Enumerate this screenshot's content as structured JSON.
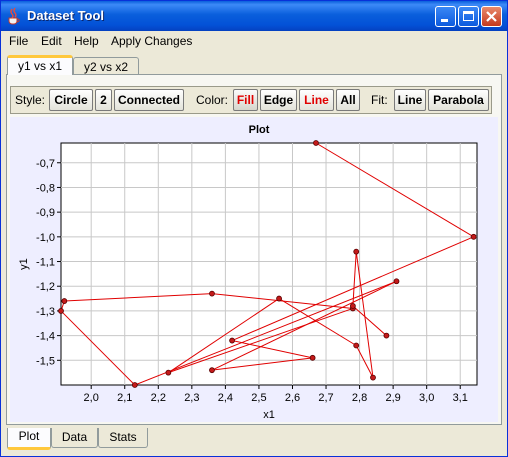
{
  "window": {
    "title": "Dataset Tool"
  },
  "menu": [
    "File",
    "Edit",
    "Help",
    "Apply Changes"
  ],
  "dataset_tabs": [
    {
      "label": "y1 vs x1",
      "active": true
    },
    {
      "label": "y2 vs x2",
      "active": false
    }
  ],
  "toolbar": {
    "style_label": "Style:",
    "style_buttons": [
      "Circle",
      "2",
      "Connected"
    ],
    "color_label": "Color:",
    "color_buttons": [
      "Fill",
      "Edge",
      "Line",
      "All"
    ],
    "fit_label": "Fit:",
    "fit_buttons": [
      "Line",
      "Parabola"
    ]
  },
  "bottom_tabs": [
    {
      "label": "Plot",
      "active": true
    },
    {
      "label": "Data",
      "active": false
    },
    {
      "label": "Stats",
      "active": false
    }
  ],
  "colors": {
    "line": "#e00000",
    "marker_fill": "#c41a1a",
    "plot_bg": "#eeeeff",
    "grid": "#c8c8c8"
  },
  "chart_data": {
    "type": "scatter",
    "title": "Plot",
    "xlabel": "x1",
    "ylabel": "y1",
    "xlim": [
      1.91,
      3.15
    ],
    "ylim": [
      -1.6,
      -0.62
    ],
    "xticks": [
      2.0,
      2.1,
      2.2,
      2.3,
      2.4,
      2.5,
      2.6,
      2.7,
      2.8,
      2.9,
      3.0,
      3.1
    ],
    "xtick_labels": [
      "2,0",
      "2,1",
      "2,2",
      "2,3",
      "2,4",
      "2,5",
      "2,6",
      "2,7",
      "2,8",
      "2,9",
      "3,0",
      "3,1"
    ],
    "yticks": [
      -0.7,
      -0.8,
      -0.9,
      -1.0,
      -1.1,
      -1.2,
      -1.3,
      -1.4,
      -1.5
    ],
    "ytick_labels": [
      "-0,7",
      "-0,8",
      "-0,9",
      "-1,0",
      "-1,1",
      "-1,2",
      "-1,3",
      "-1,4",
      "-1,5"
    ],
    "connected": true,
    "marker": "circle",
    "points": [
      {
        "x": 2.67,
        "y": -0.62
      },
      {
        "x": 3.14,
        "y": -1.0
      },
      {
        "x": 2.42,
        "y": -1.42
      },
      {
        "x": 2.66,
        "y": -1.49
      },
      {
        "x": 2.36,
        "y": -1.54
      },
      {
        "x": 2.91,
        "y": -1.18
      },
      {
        "x": 2.13,
        "y": -1.6
      },
      {
        "x": 1.91,
        "y": -1.3
      },
      {
        "x": 1.92,
        "y": -1.26
      },
      {
        "x": 2.36,
        "y": -1.23
      },
      {
        "x": 2.78,
        "y": -1.29
      },
      {
        "x": 2.23,
        "y": -1.55
      },
      {
        "x": 2.56,
        "y": -1.25
      },
      {
        "x": 2.79,
        "y": -1.44
      },
      {
        "x": 2.84,
        "y": -1.57
      },
      {
        "x": 2.79,
        "y": -1.06
      },
      {
        "x": 2.78,
        "y": -1.28
      },
      {
        "x": 2.88,
        "y": -1.4
      }
    ]
  }
}
